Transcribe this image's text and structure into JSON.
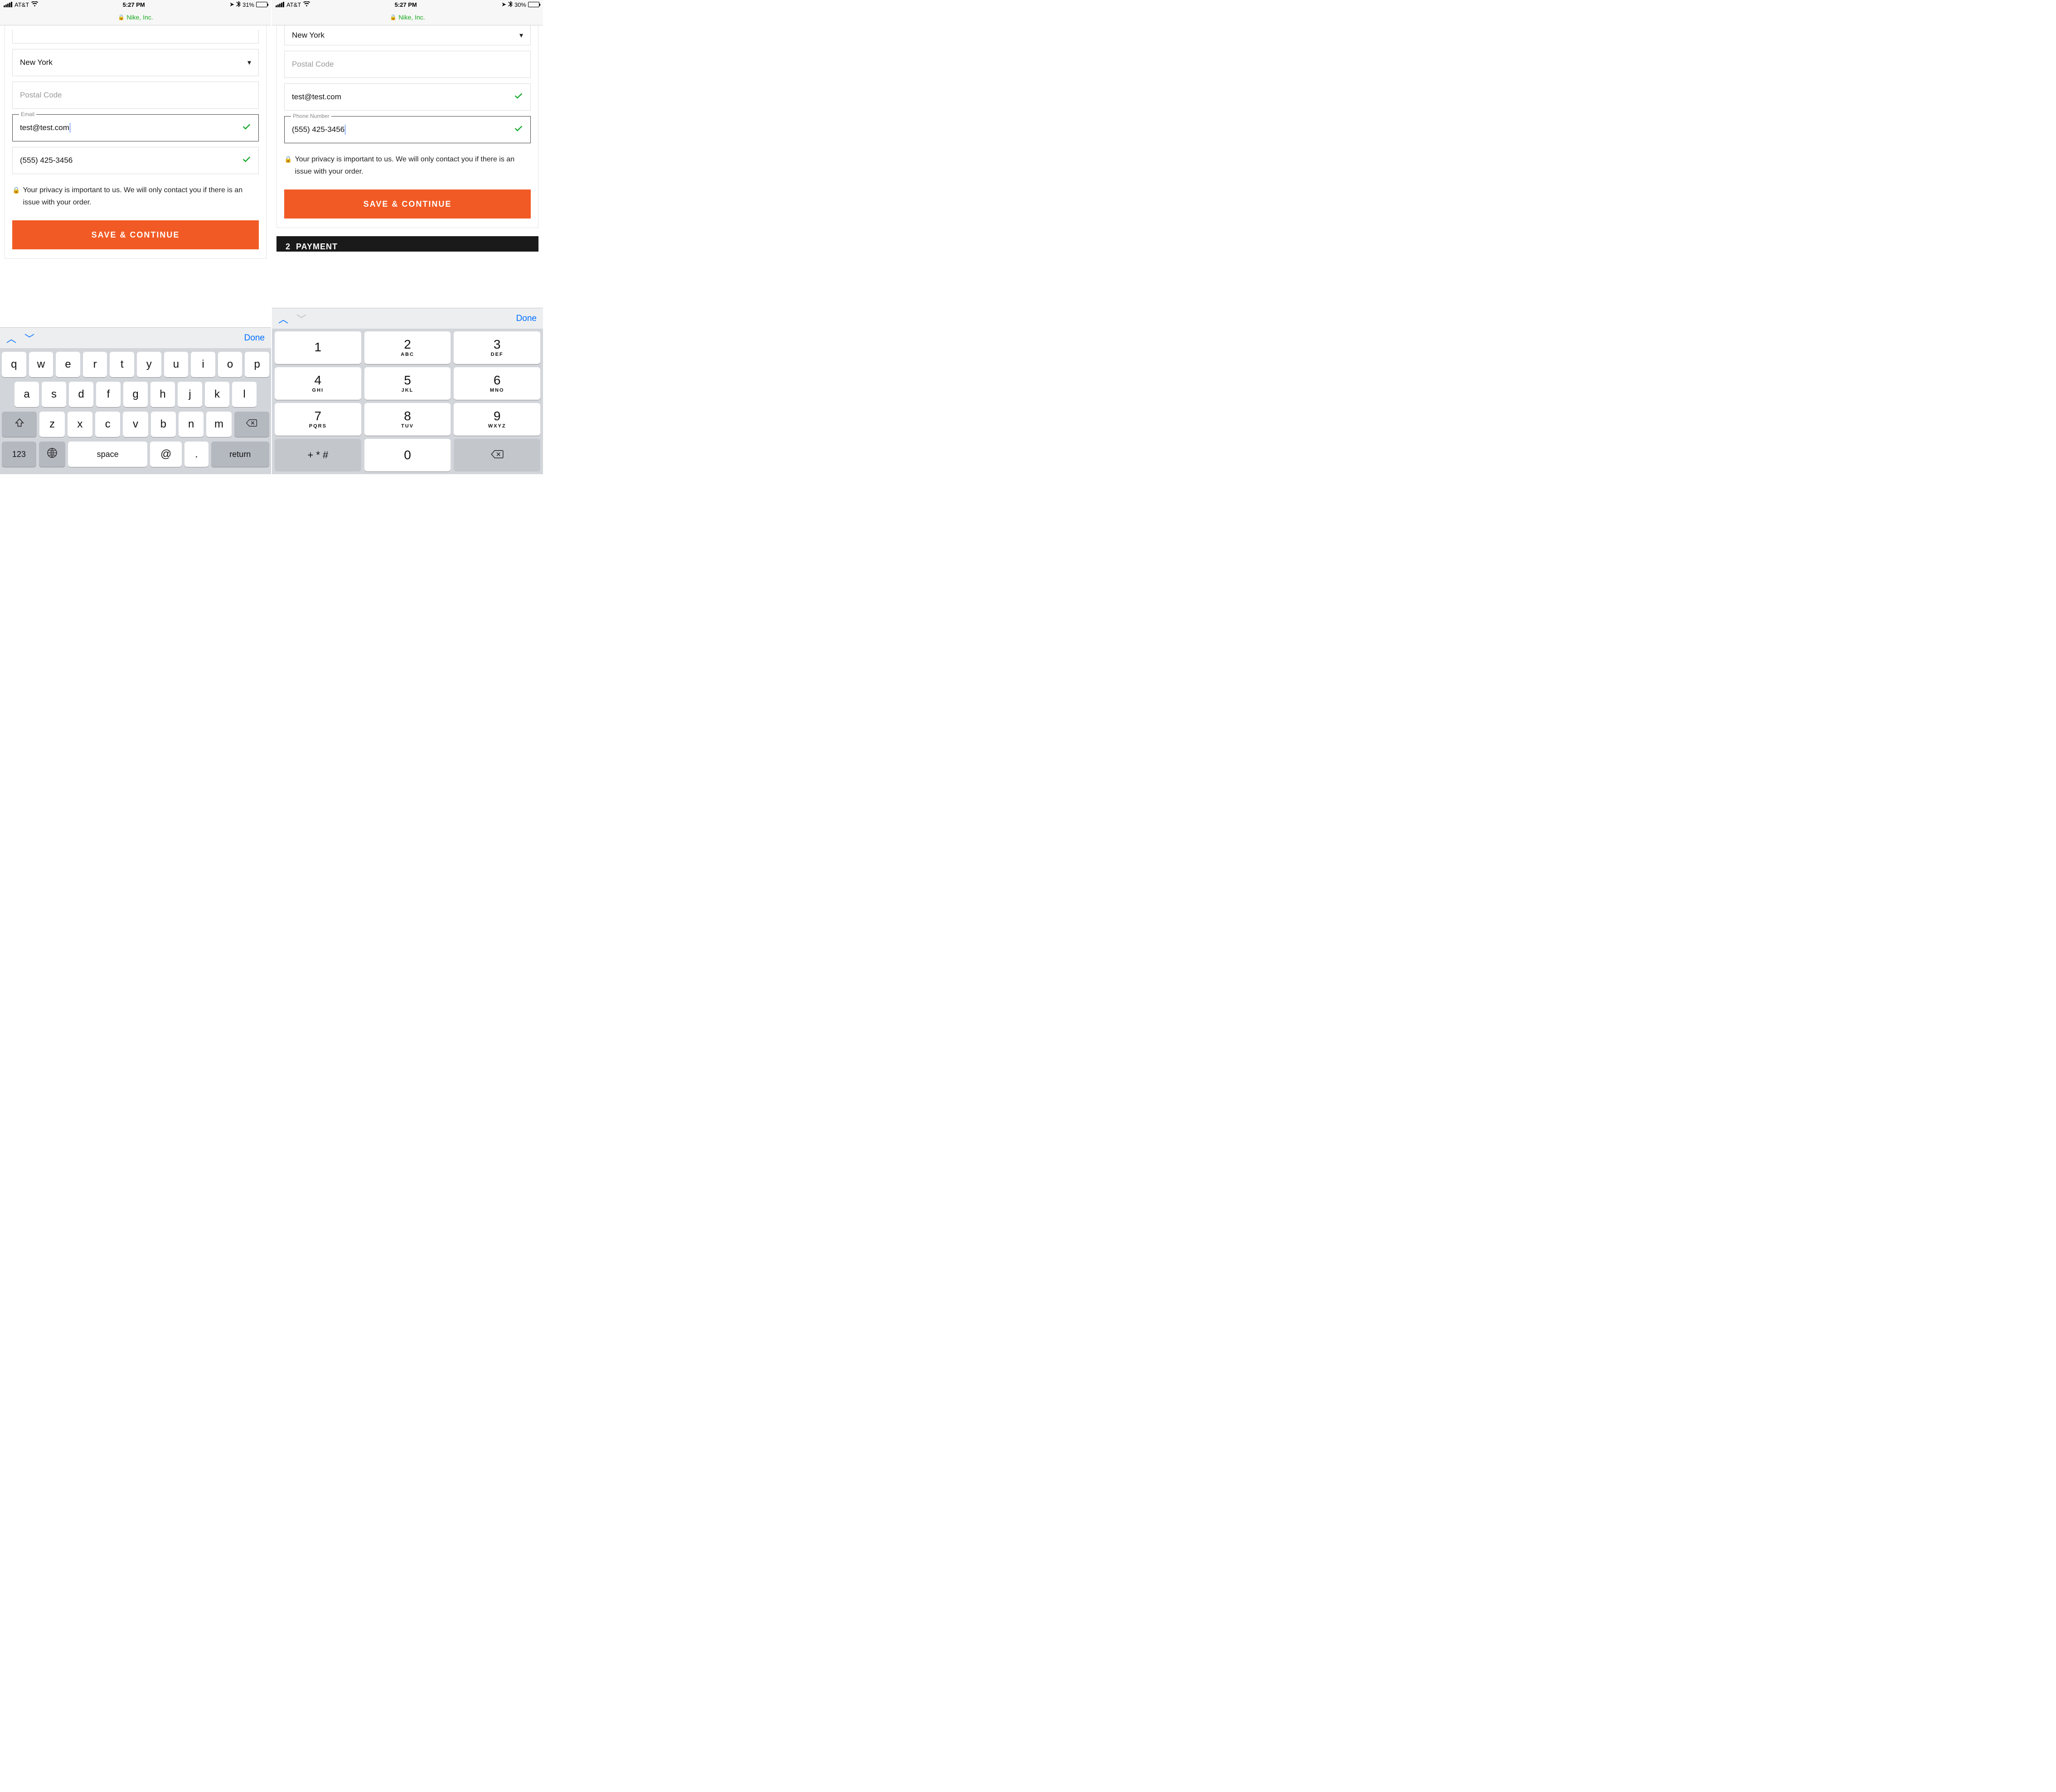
{
  "left": {
    "status": {
      "carrier": "AT&T",
      "time": "5:27 PM",
      "battery_pct": "31%"
    },
    "safari_site": "Nike, Inc.",
    "form": {
      "state_value": "New York",
      "postal_placeholder": "Postal Code",
      "email_label": "Email",
      "email_value": "test@test.com",
      "phone_value": "(555) 425-3456",
      "privacy": "Your privacy is important to us. We will only contact you if there is an issue with your order.",
      "save_label": "SAVE & CONTINUE"
    },
    "kb": {
      "done": "Done",
      "row1": [
        "q",
        "w",
        "e",
        "r",
        "t",
        "y",
        "u",
        "i",
        "o",
        "p"
      ],
      "row2": [
        "a",
        "s",
        "d",
        "f",
        "g",
        "h",
        "j",
        "k",
        "l"
      ],
      "row3": [
        "z",
        "x",
        "c",
        "v",
        "b",
        "n",
        "m"
      ],
      "num": "123",
      "space": "space",
      "at": "@",
      "dot": ".",
      "ret": "return"
    }
  },
  "right": {
    "status": {
      "carrier": "AT&T",
      "time": "5:27 PM",
      "battery_pct": "30%"
    },
    "safari_site": "Nike, Inc.",
    "form": {
      "state_value": "New York",
      "postal_placeholder": "Postal Code",
      "email_value": "test@test.com",
      "phone_label": "Phone Number",
      "phone_value": "(555) 425-3456",
      "privacy": "Your privacy is important to us. We will only contact you if there is an issue with your order.",
      "save_label": "SAVE & CONTINUE",
      "next_section_num": "2",
      "next_section_title": "PAYMENT"
    },
    "kb": {
      "done": "Done",
      "keys": [
        {
          "d": "1",
          "l": ""
        },
        {
          "d": "2",
          "l": "ABC"
        },
        {
          "d": "3",
          "l": "DEF"
        },
        {
          "d": "4",
          "l": "GHI"
        },
        {
          "d": "5",
          "l": "JKL"
        },
        {
          "d": "6",
          "l": "MNO"
        },
        {
          "d": "7",
          "l": "PQRS"
        },
        {
          "d": "8",
          "l": "TUV"
        },
        {
          "d": "9",
          "l": "WXYZ"
        }
      ],
      "sym": "+ * #",
      "zero": "0"
    }
  }
}
